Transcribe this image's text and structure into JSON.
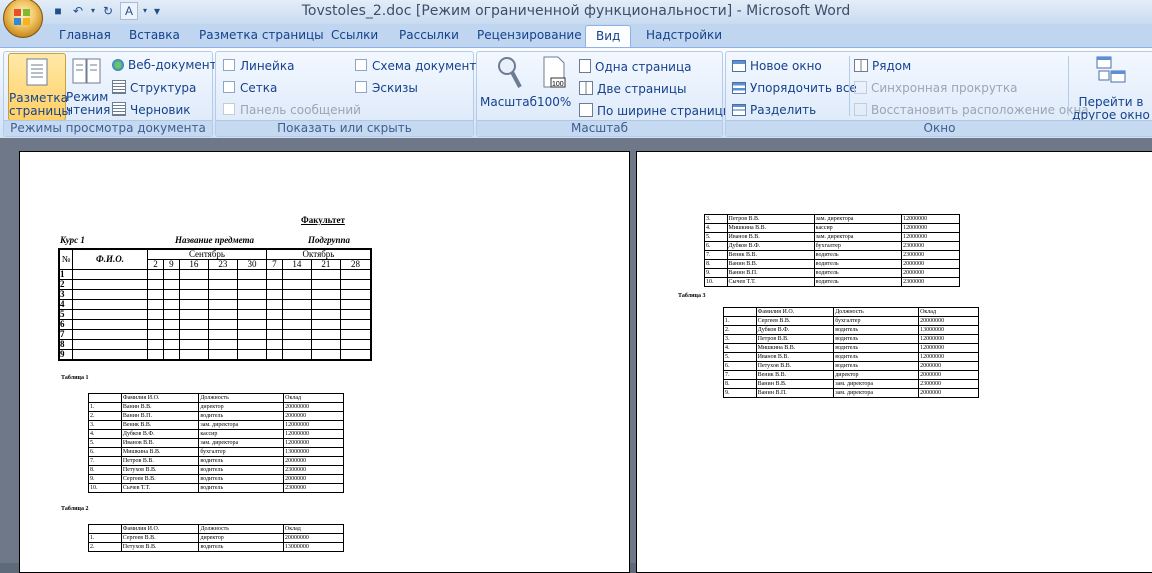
{
  "window": {
    "title": "Tovstoles_2.doc [Режим ограниченной функциональности] - Microsoft Word"
  },
  "tabs": [
    "Главная",
    "Вставка",
    "Разметка страницы",
    "Ссылки",
    "Рассылки",
    "Рецензирование",
    "Вид",
    "Надстройки"
  ],
  "active_tab": "Вид",
  "ribbon": {
    "views": {
      "label": "Режимы просмотра документа",
      "print_layout": "Разметка страницы",
      "reading": "Режим чтения",
      "web": "Веб-документ",
      "outline": "Структура",
      "draft": "Черновик"
    },
    "show": {
      "label": "Показать или скрыть",
      "ruler": "Линейка",
      "grid": "Сетка",
      "message_bar": "Панель сообщений",
      "doc_map": "Схема документа",
      "thumbnails": "Эскизы"
    },
    "zoom": {
      "label": "Масштаб",
      "zoom": "Масштаб",
      "hundred": "100%",
      "one_page": "Одна страница",
      "two_pages": "Две страницы",
      "page_width": "По ширине страницы"
    },
    "window": {
      "label": "Окно",
      "new_window": "Новое окно",
      "arrange_all": "Упорядочить все",
      "split": "Разделить",
      "side_by_side": "Рядом",
      "sync_scroll": "Синхронная прокрутка",
      "reset_pos": "Восстановить расположение окна",
      "switch": "Перейти в другое окно"
    }
  },
  "page1": {
    "faculty": "Факультет",
    "course": "Курс 1",
    "subject": "Название предмета",
    "subgroup": "Подгруппа",
    "num_header": "№",
    "name_header": "Ф.И.О.",
    "month1": "Сентябрь",
    "month2": "Октябрь",
    "days": [
      "2",
      "9",
      "16",
      "23",
      "30",
      "7",
      "14",
      "21",
      "28"
    ],
    "row_numbers": [
      "1",
      "2",
      "3",
      "4",
      "5",
      "6",
      "7",
      "8",
      "9"
    ],
    "table1_caption": "Таблица 1",
    "table2_caption": "Таблица 2"
  },
  "page2": {
    "table3_caption": "Таблица 3"
  },
  "table_headers": [
    "",
    "Фамилия И.О.",
    "Должность",
    "Оклад"
  ],
  "table1": [
    [
      "1.",
      "Ванин В.В.",
      "директор",
      "20000000"
    ],
    [
      "2.",
      "Ванин В.П.",
      "водитель",
      "2000000"
    ],
    [
      "3.",
      "Веник В.В.",
      "зам. директора",
      "12000000"
    ],
    [
      "4.",
      "Дубков В.Ф.",
      "кассир",
      "12000000"
    ],
    [
      "5.",
      "Иванов В.В.",
      "зам. директора",
      "12000000"
    ],
    [
      "6.",
      "Мишкина В.В.",
      "бухгалтер",
      "13000000"
    ],
    [
      "7.",
      "Петров В.В.",
      "водитель",
      "2000000"
    ],
    [
      "8.",
      "Петухов В.В.",
      "водитель",
      "2300000"
    ],
    [
      "9.",
      "Сергеев В.В.",
      "водитель",
      "2000000"
    ],
    [
      "10.",
      "Сычев Т.Т.",
      "водитель",
      "2300000"
    ]
  ],
  "table2": [
    [
      "1.",
      "Сергеев В.В.",
      "директор",
      "20000000"
    ],
    [
      "2.",
      "Петухов В.В.",
      "водитель",
      "13000000"
    ]
  ],
  "table2_cont": [
    [
      "3.",
      "Петров В.В.",
      "зам. директора",
      "12000000"
    ],
    [
      "4.",
      "Мишкина В.В.",
      "кассир",
      "12000000"
    ],
    [
      "5.",
      "Иванов В.В.",
      "зам. директора",
      "12000000"
    ],
    [
      "6.",
      "Дубков В.Ф.",
      "бухгалтер",
      "2300000"
    ],
    [
      "7.",
      "Веник В.В.",
      "водитель",
      "2300000"
    ],
    [
      "8.",
      "Ванин В.В.",
      "водитель",
      "2000000"
    ],
    [
      "9.",
      "Ванин В.П.",
      "водитель",
      "2000000"
    ],
    [
      "10.",
      "Сычев Т.Т.",
      "водитель",
      "2300000"
    ]
  ],
  "table3": [
    [
      "1.",
      "Сергеев В.В.",
      "бухгалтер",
      "20000000"
    ],
    [
      "2.",
      "Дубков В.Ф.",
      "водитель",
      "13000000"
    ],
    [
      "3.",
      "Петров В.В.",
      "водитель",
      "12000000"
    ],
    [
      "4.",
      "Мишкина В.В.",
      "водитель",
      "12000000"
    ],
    [
      "5.",
      "Иванов В.В.",
      "водитель",
      "12000000"
    ],
    [
      "6.",
      "Петухов В.В.",
      "водитель",
      "2000000"
    ],
    [
      "7.",
      "Веник В.В.",
      "директор",
      "2000000"
    ],
    [
      "8.",
      "Ванин В.В.",
      "зам. директора",
      "2300000"
    ],
    [
      "9.",
      "Ванин В.П.",
      "зам. директора",
      "2000000"
    ]
  ]
}
